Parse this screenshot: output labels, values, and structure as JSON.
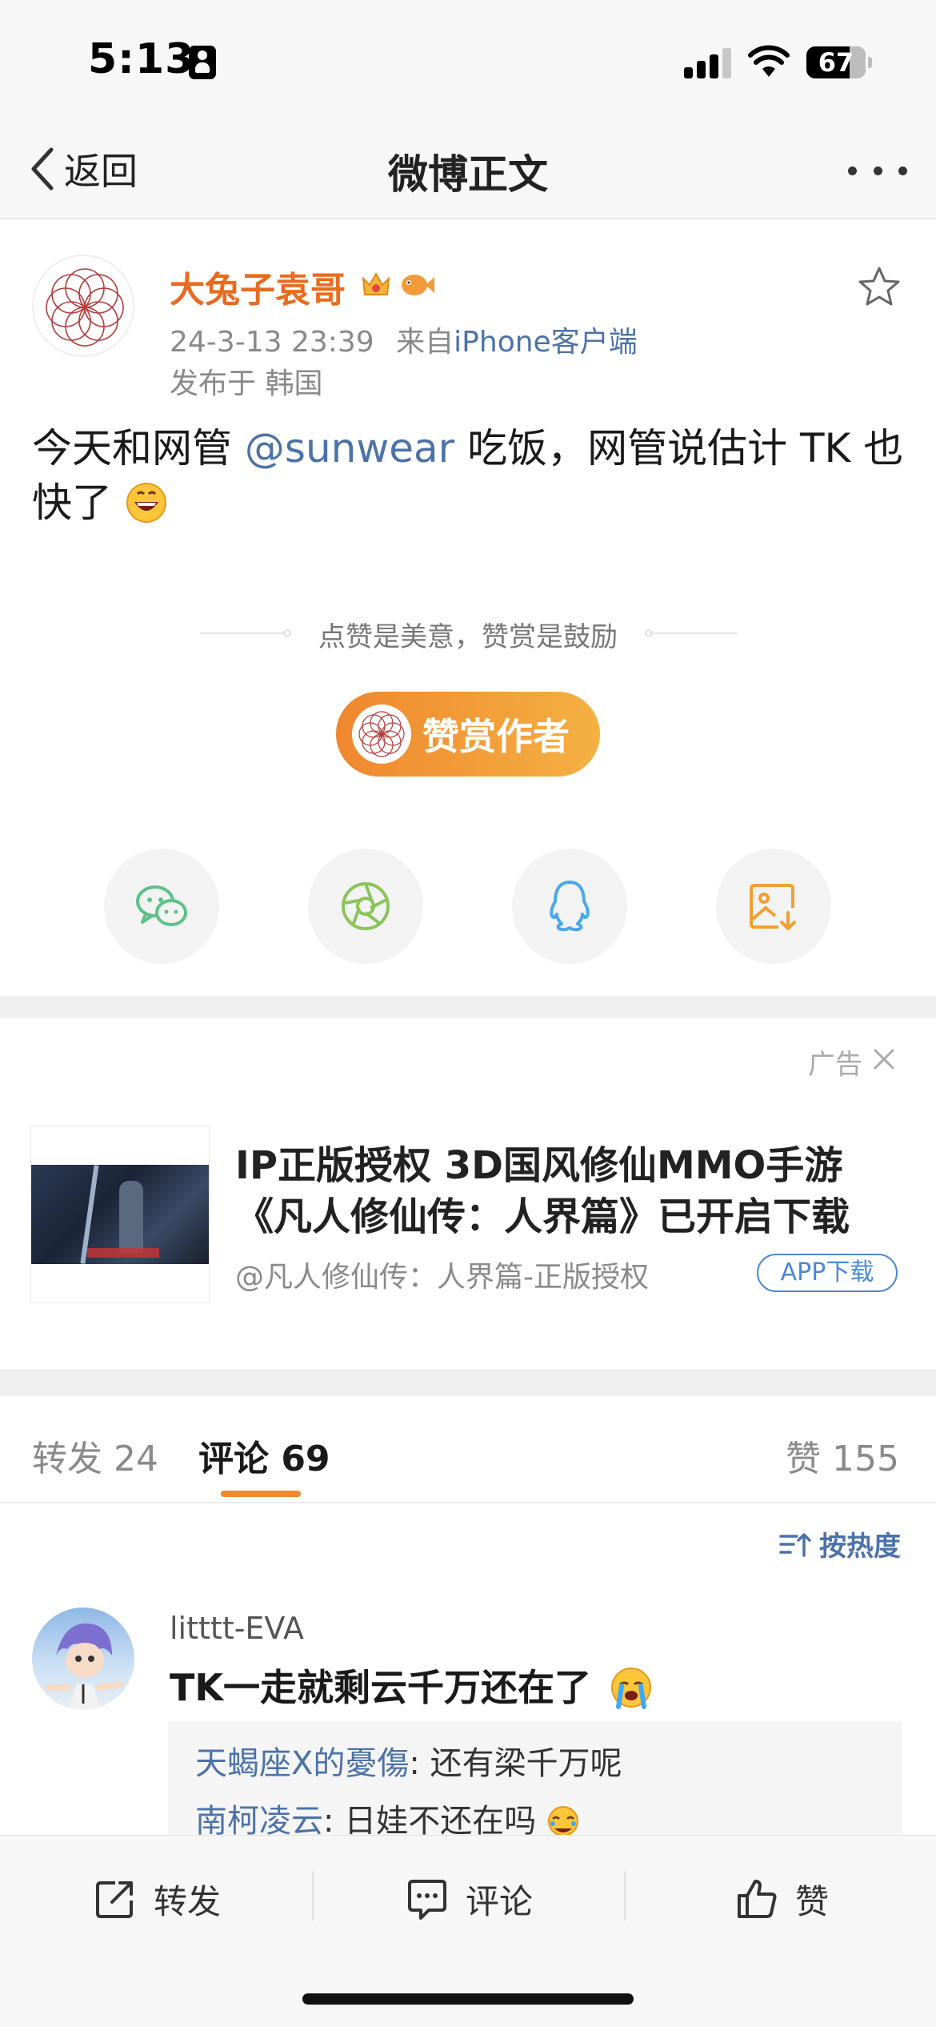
{
  "status_bar": {
    "time": "5:13",
    "battery": "67"
  },
  "nav": {
    "back_label": "返回",
    "title": "微博正文"
  },
  "post": {
    "author": "大兔子袁哥",
    "timestamp": "24-3-13 23:39",
    "source_prefix": "来自",
    "source": "iPhone客户端",
    "location": "发布于 韩国",
    "text_before_mention": "今天和网管",
    "mention": "@sunwear",
    "text_after_mention": "吃饭，网管说估计 TK 也快了"
  },
  "reward": {
    "tip_text": "点赞是美意，赞赏是鼓励",
    "button_label": "赞赏作者"
  },
  "share": {
    "icons": [
      "wechat-icon",
      "moments-icon",
      "qq-icon",
      "save-image-icon"
    ]
  },
  "ad": {
    "label": "广告",
    "title_line1": "IP正版授权 3D国风修仙MMO手游",
    "title_line2": "《凡人修仙传：人界篇》已开启下载",
    "source": "@凡人修仙传：人界篇-正版授权",
    "app_button": "APP下载"
  },
  "tabs": {
    "repost": "转发 24",
    "comment": "评论 69",
    "like": "赞 155",
    "sort": "按热度"
  },
  "comments": [
    {
      "user": "litttt-EVA",
      "text": "TK一走就剩云千万还在了",
      "replies": [
        {
          "user": "天蝎座X的憂傷",
          "text": ": 还有梁千万呢"
        },
        {
          "user": "南柯凌云",
          "text": ": 日娃不还在吗"
        }
      ]
    }
  ],
  "bottom_bar": {
    "repost": "转发",
    "comment": "评论",
    "like": "赞"
  },
  "colors": {
    "accent_orange": "#f08a2e",
    "link_blue": "#4c72a8",
    "username_orange": "#e86b1f"
  }
}
